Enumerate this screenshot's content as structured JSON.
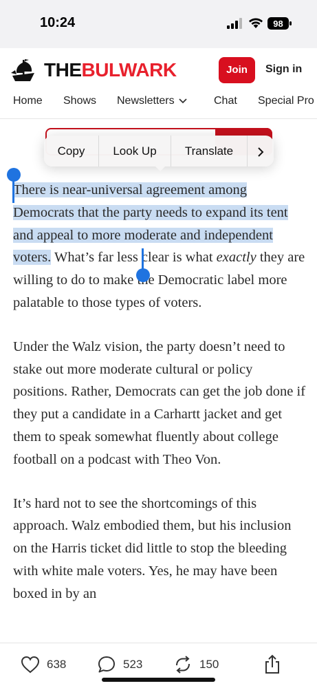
{
  "status_bar": {
    "time": "10:24",
    "battery": "98"
  },
  "header": {
    "brand_the": "THE",
    "brand_bulwark": "BULWARK",
    "join_label": "Join",
    "signin_label": "Sign in",
    "brand_color": "#e8212d"
  },
  "nav": {
    "items": [
      {
        "label": "Home"
      },
      {
        "label": "Shows"
      },
      {
        "label": "Newsletters"
      },
      {
        "label": "Chat"
      },
      {
        "label": "Special Pro"
      }
    ]
  },
  "context_menu": {
    "items": [
      {
        "label": "Copy"
      },
      {
        "label": "Look Up"
      },
      {
        "label": "Translate"
      }
    ],
    "more_icon": "chevron-right-icon"
  },
  "article": {
    "p1_selected": "There is near-universal agreement among Democrats that the party needs to expand its tent and appeal to more moderate and independent voters.",
    "p1_rest_a": " What’s far less clear is what ",
    "p1_italic": "exactly",
    "p1_rest_b": " they are willing to do to make the Democratic label more palatable to those types of voters.",
    "p2": "Under the Walz vision, the party doesn’t need to stake out more moderate cultural or policy positions. Rather, Democrats can get the job done if they put a candidate in a Carhartt jacket and get them to speak somewhat fluently about college football on a podcast with Theo Von.",
    "p3": "It’s hard not to see the shortcomings of this approach. Walz embodied them, but his inclusion on the Harris ticket did little to stop the bleeding with white male voters. Yes, he may have been boxed in by an",
    "selection_color": "#c9dcf2"
  },
  "bottom_bar": {
    "likes": "638",
    "comments": "523",
    "restacks": "150"
  }
}
